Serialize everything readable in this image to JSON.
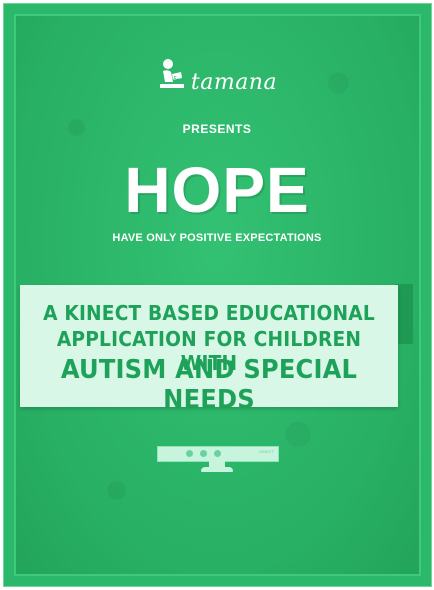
{
  "brand": {
    "logo_text": "tamana",
    "logo_icon": "reading-person-icon"
  },
  "presents": "PRESENTS",
  "title": "HOPE",
  "subtitle": "HAVE ONLY POSITIVE EXPECTATIONS",
  "banner": {
    "line1": "A KINECT BASED EDUCATIONAL",
    "line2": "APPLICATION FOR CHILDREN WITH",
    "line3": "AUTISM AND SPECIAL NEEDS"
  },
  "device": {
    "label": "KINECT",
    "icon": "kinect-sensor-icon"
  },
  "colors": {
    "background_green": "#2bb86a",
    "banner_bg": "#d9f7e6",
    "banner_text": "#1ea25a",
    "text_white": "#ffffff"
  }
}
